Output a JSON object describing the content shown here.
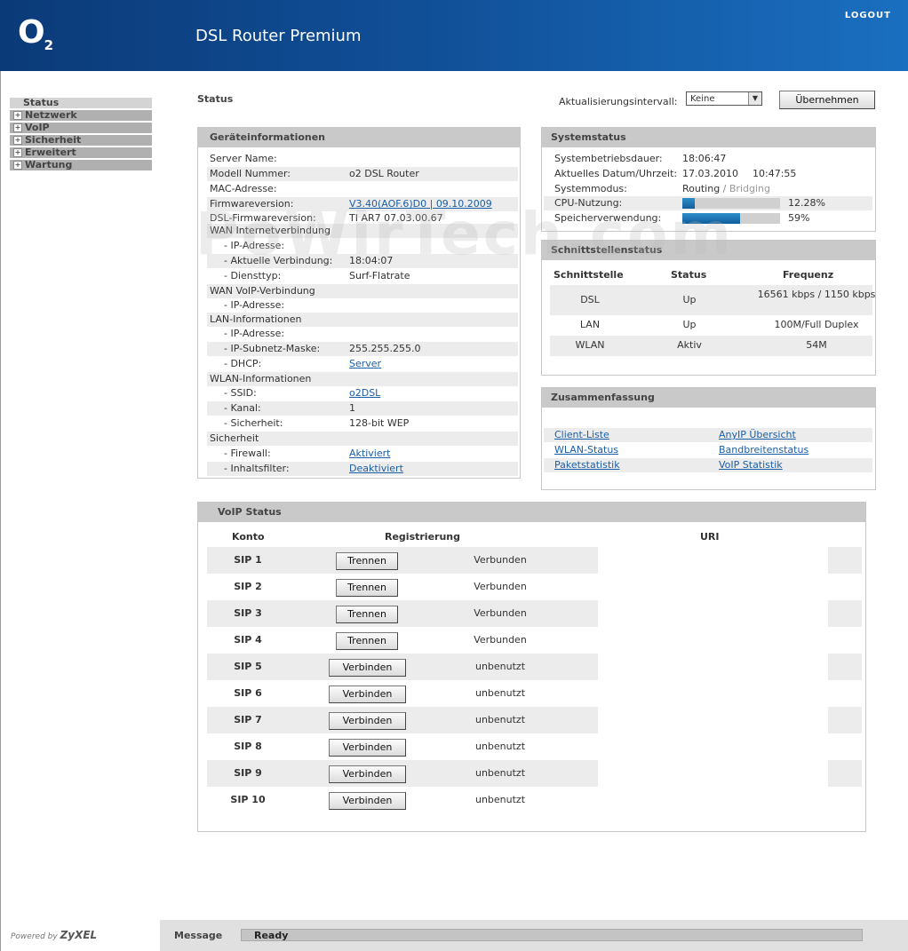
{
  "header": {
    "logo": "O",
    "logo_sub": "2",
    "product": "DSL Router Premium",
    "logout": "LOGOUT"
  },
  "sidebar": {
    "items": [
      {
        "label": "Status",
        "active": true
      },
      {
        "label": "Netzwerk",
        "active": false
      },
      {
        "label": "VoIP",
        "active": false
      },
      {
        "label": "Sicherheit",
        "active": false
      },
      {
        "label": "Erweitert",
        "active": false
      },
      {
        "label": "Wartung",
        "active": false
      }
    ]
  },
  "page": {
    "title": "Status"
  },
  "refresh": {
    "label": "Aktualisierungsintervall:",
    "value": "Keine",
    "apply": "Übernehmen"
  },
  "device": {
    "title": "Geräteinformationen",
    "rows": [
      {
        "key": "Server Name:",
        "value": ""
      },
      {
        "key": "Modell Nummer:",
        "value": "o2 DSL Router"
      },
      {
        "key": "MAC-Adresse:",
        "value": ""
      },
      {
        "key": "Firmwareversion:",
        "value": "V3.40(AOF.6)D0 | 09.10.2009"
      },
      {
        "key": "DSL-Firmwareversion:",
        "value": "TI AR7 07.03.00.67"
      },
      {
        "key": "WAN Internetverbindung",
        "value": ""
      },
      {
        "key": "- IP-Adresse:",
        "value": ""
      },
      {
        "key": "- Aktuelle Verbindung:",
        "value": "18:04:07"
      },
      {
        "key": "- Diensttyp:",
        "value": "Surf-Flatrate"
      },
      {
        "key": "WAN VoIP-Verbindung",
        "value": ""
      },
      {
        "key": "- IP-Adresse:",
        "value": ""
      },
      {
        "key": "LAN-Informationen",
        "value": ""
      },
      {
        "key": "- IP-Adresse:",
        "value": ""
      },
      {
        "key": "- IP-Subnetz-Maske:",
        "value": "255.255.255.0"
      },
      {
        "key": "- DHCP:",
        "value": "Server"
      },
      {
        "key": "WLAN-Informationen",
        "value": ""
      },
      {
        "key": "- SSID:",
        "value": "o2DSL"
      },
      {
        "key": "- Kanal:",
        "value": "1"
      },
      {
        "key": "- Sicherheit:",
        "value": "128-bit WEP"
      },
      {
        "key": "Sicherheit",
        "value": ""
      },
      {
        "key": "- Firewall:",
        "value": "Aktiviert"
      },
      {
        "key": "- Inhaltsfilter:",
        "value": "Deaktiviert"
      }
    ]
  },
  "system": {
    "title": "Systemstatus",
    "uptime_label": "Systembetriebsdauer:",
    "uptime": "18:06:47",
    "datetime_label": "Aktuelles Datum/Uhrzeit:",
    "date": "17.03.2010",
    "time": "10:47:55",
    "mode_label": "Systemmodus:",
    "mode_active": "Routing",
    "mode_sep": " / ",
    "mode_inactive": "Bridging",
    "cpu_label": "CPU-Nutzung:",
    "cpu_text": "12.28%",
    "cpu_percent": 12.28,
    "mem_label": "Speicherverwendung:",
    "mem_text": "59%",
    "mem_percent": 59
  },
  "interfaces": {
    "title": "Schnittstellenstatus",
    "headers": [
      "Schnittstelle",
      "Status",
      "Frequenz"
    ],
    "rows": [
      {
        "name": "DSL",
        "status": "Up",
        "freq": "16561 kbps / 1150 kbps"
      },
      {
        "name": "LAN",
        "status": "Up",
        "freq": "100M/Full Duplex"
      },
      {
        "name": "WLAN",
        "status": "Aktiv",
        "freq": "54M"
      }
    ]
  },
  "summary": {
    "title": "Zusammenfassung",
    "links": [
      [
        "Client-Liste",
        "AnyIP Übersicht"
      ],
      [
        "WLAN-Status",
        "Bandbreitenstatus"
      ],
      [
        "Paketstatistik",
        "VoIP Statistik"
      ]
    ]
  },
  "voip": {
    "title": "VoIP Status",
    "headers": {
      "account": "Konto",
      "registration": "Registrierung",
      "uri": "URI"
    },
    "rows": [
      {
        "account": "SIP 1",
        "button": "Trennen",
        "status": "Verbunden"
      },
      {
        "account": "SIP 2",
        "button": "Trennen",
        "status": "Verbunden"
      },
      {
        "account": "SIP 3",
        "button": "Trennen",
        "status": "Verbunden"
      },
      {
        "account": "SIP 4",
        "button": "Trennen",
        "status": "Verbunden"
      },
      {
        "account": "SIP 5",
        "button": "Verbinden",
        "status": "unbenutzt"
      },
      {
        "account": "SIP 6",
        "button": "Verbinden",
        "status": "unbenutzt"
      },
      {
        "account": "SIP 7",
        "button": "Verbinden",
        "status": "unbenutzt"
      },
      {
        "account": "SIP 8",
        "button": "Verbinden",
        "status": "unbenutzt"
      },
      {
        "account": "SIP 9",
        "button": "Verbinden",
        "status": "unbenutzt"
      },
      {
        "account": "SIP 10",
        "button": "Verbinden",
        "status": "unbenutzt"
      }
    ]
  },
  "footer": {
    "powered": "Powered by",
    "brand": "ZyXEL",
    "message_label": "Message",
    "message": "Ready"
  },
  "watermark": "PoWirTech.com",
  "colors": {
    "header_start": "#0b3a78",
    "header_end": "#1a6fc0",
    "link": "#1a5ea8",
    "bar_fill": "#0f5d9a",
    "panel_header": "#c9c9c9"
  }
}
